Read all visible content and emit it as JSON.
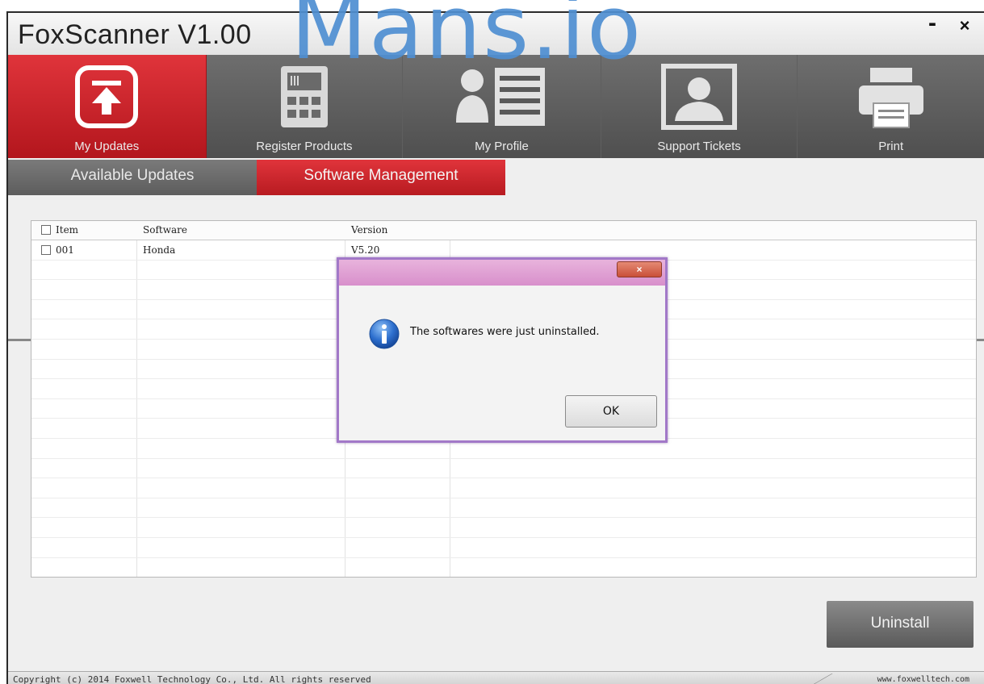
{
  "window": {
    "title": "FoxScanner  V1.00",
    "minimize_glyph": "-",
    "close_glyph": "×"
  },
  "watermark": "Mans.io",
  "nav": {
    "items": [
      {
        "label": "My Updates",
        "icon": "upload-icon",
        "active": true
      },
      {
        "label": "Register Products",
        "icon": "calculator-icon",
        "active": false
      },
      {
        "label": "My Profile",
        "icon": "profile-list-icon",
        "active": false
      },
      {
        "label": "Support Tickets",
        "icon": "person-card-icon",
        "active": false
      },
      {
        "label": "Print",
        "icon": "printer-icon",
        "active": false
      }
    ]
  },
  "subtabs": [
    {
      "label": "Available Updates",
      "active": false
    },
    {
      "label": "Software Management",
      "active": true
    }
  ],
  "table": {
    "columns": [
      "Item",
      "Software",
      "Version"
    ],
    "rows": [
      {
        "item": "001",
        "software": "Honda",
        "version": "V5.20"
      }
    ]
  },
  "uninstall_label": "Uninstall",
  "status": {
    "copyright": "Copyright (c) 2014 Foxwell Technology Co., Ltd. All rights reserved",
    "website": "www.foxwelltech.com"
  },
  "dialog": {
    "message": "The softwares were just uninstalled.",
    "ok_label": "OK",
    "icon": "info-icon"
  },
  "colors": {
    "accent_red": "#c8232a",
    "nav_gray": "#5e5e5e",
    "dialog_border": "#a278c8"
  }
}
